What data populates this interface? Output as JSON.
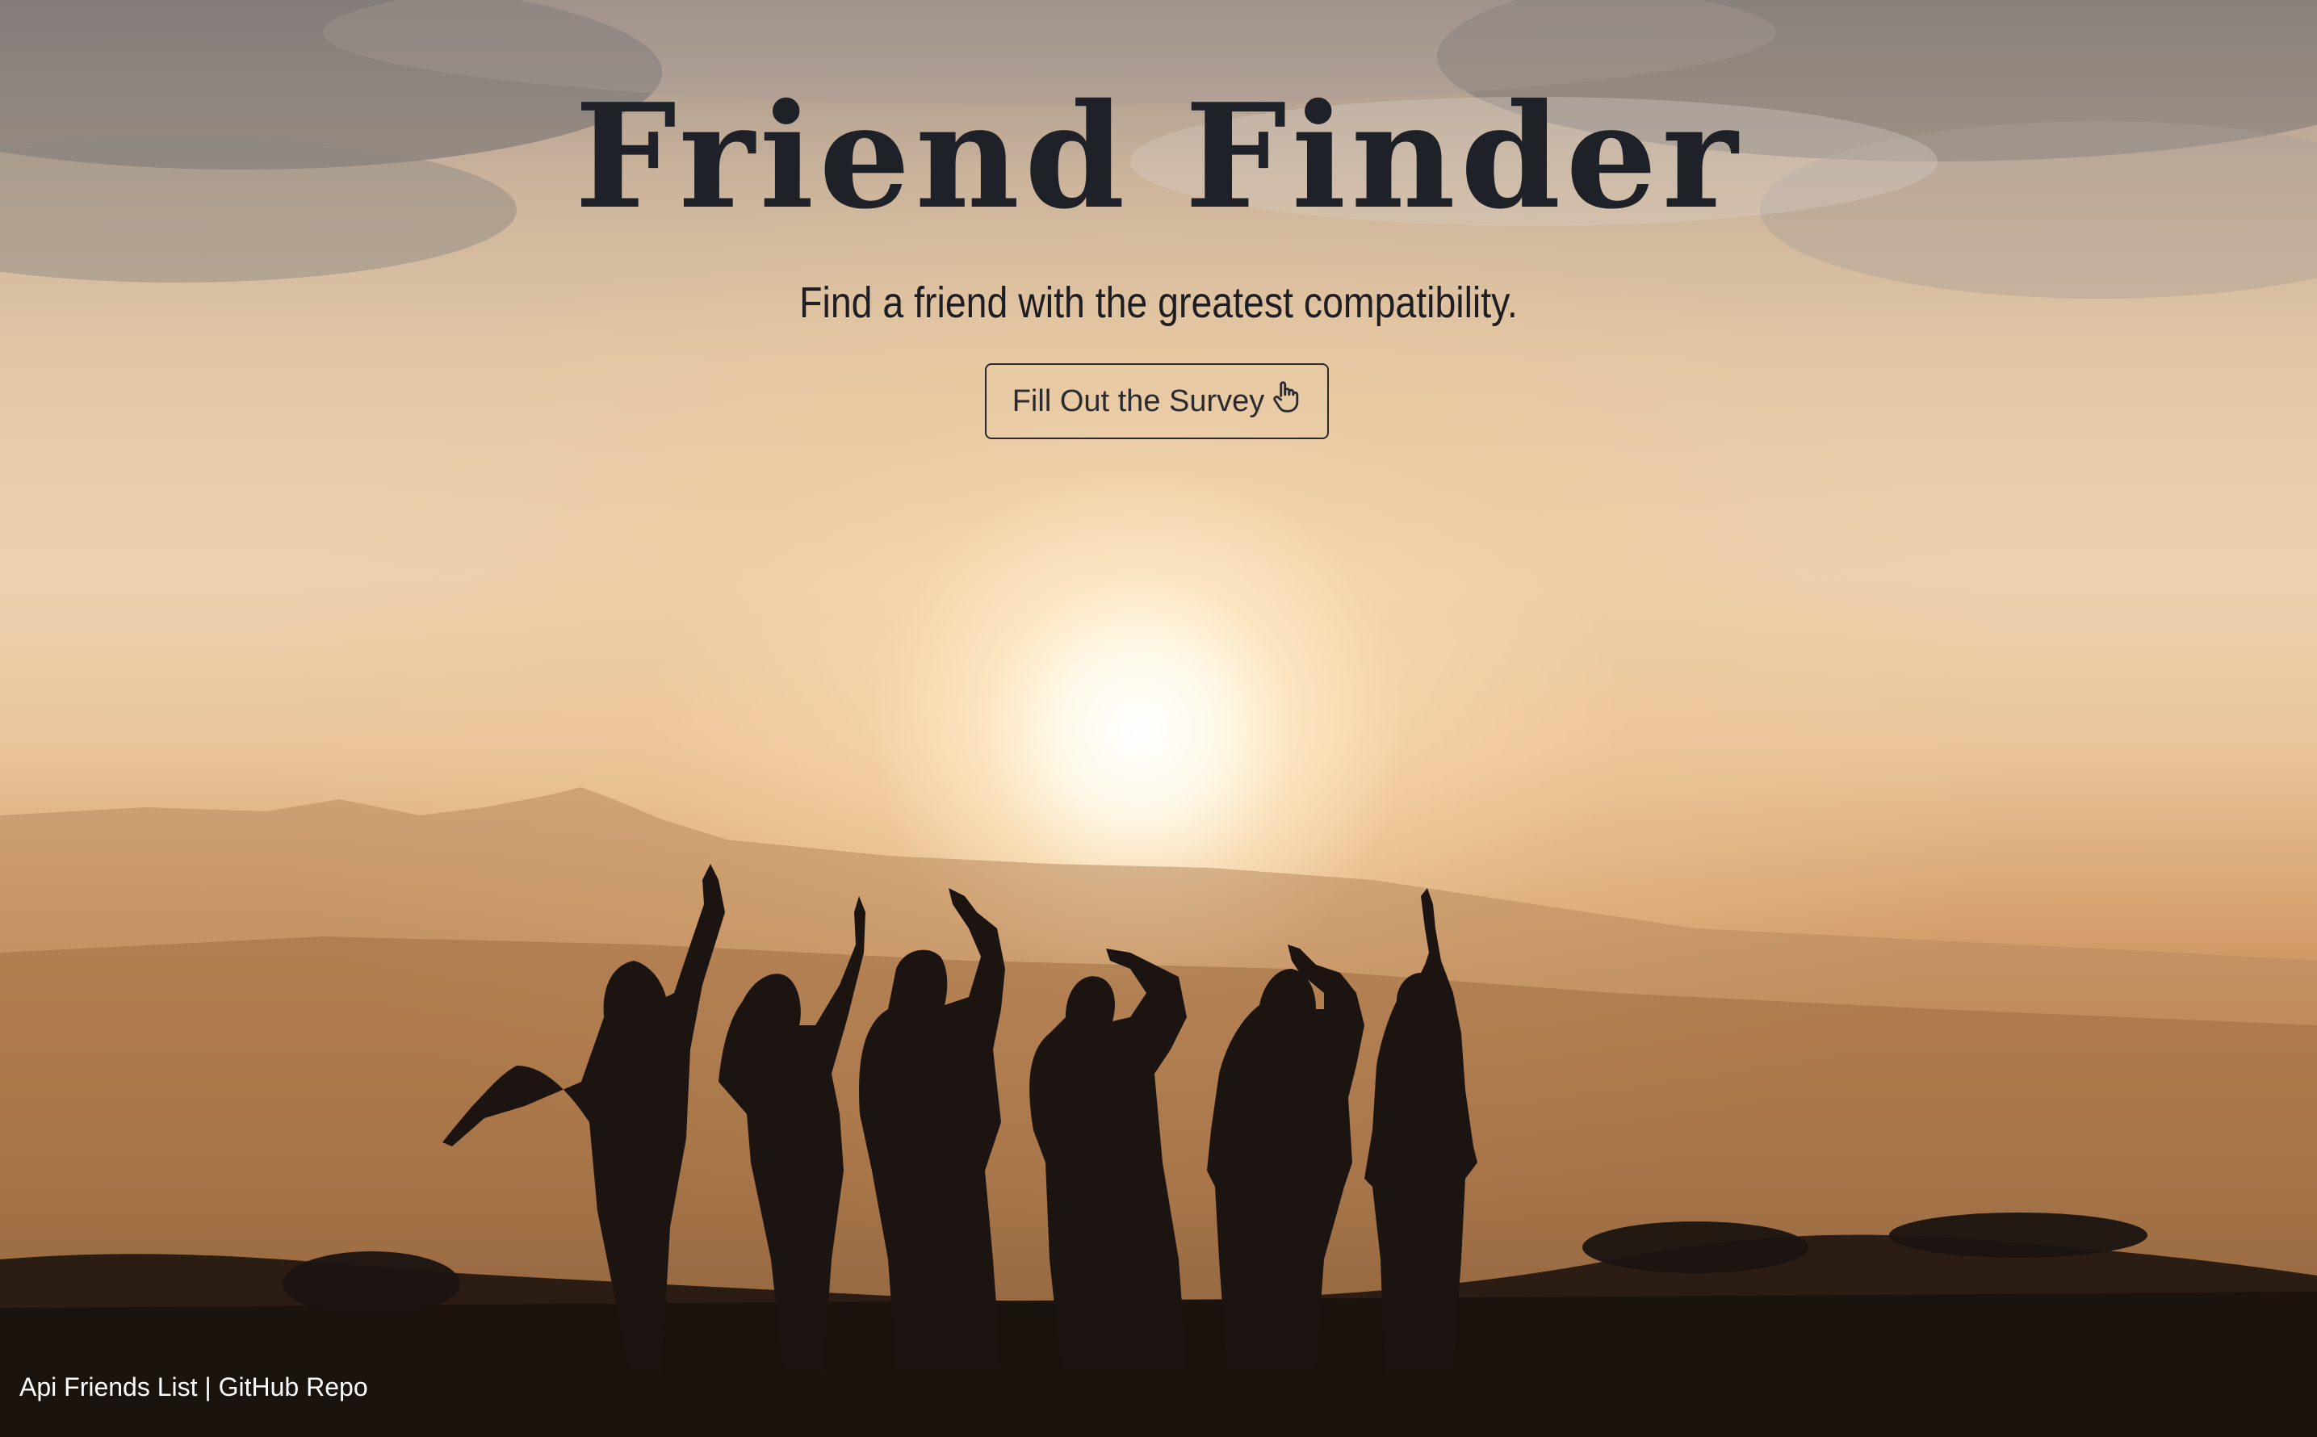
{
  "hero": {
    "title": "Friend Finder",
    "subtitle": "Find a friend with the greatest compatibility.",
    "button_label": "Fill Out the Survey",
    "button_icon": "hand-pointer-icon"
  },
  "footer": {
    "links": [
      {
        "label": "Api Friends List"
      },
      {
        "label": "GitHub Repo"
      }
    ],
    "separator": "|"
  },
  "colors": {
    "title": "#1f2128",
    "sky_top": "#9c9088",
    "sunset_glow": "#ecd2b0",
    "ground": "#241812",
    "footer_text": "#ffffff"
  }
}
